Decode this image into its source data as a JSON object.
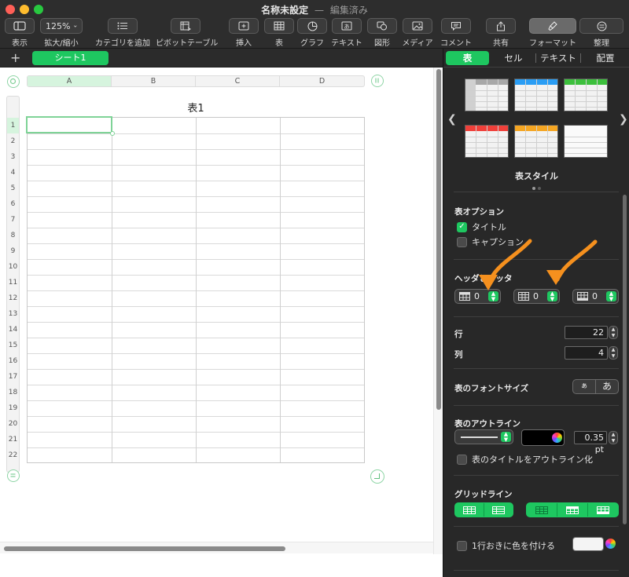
{
  "window": {
    "title": "名称未設定",
    "separator": "—",
    "status": "編集済み"
  },
  "toolbar": {
    "view_label": "表示",
    "zoom_value": "125%",
    "zoom_label": "拡大/縮小",
    "categories_label": "カテゴリを追加",
    "pivot_label": "ピボットテーブル",
    "insert_label": "挿入",
    "table_label": "表",
    "chart_label": "グラフ",
    "text_label": "テキスト",
    "shape_label": "図形",
    "media_label": "メディア",
    "comment_label": "コメント",
    "share_label": "共有",
    "format_label": "フォーマット",
    "organize_label": "整理"
  },
  "sheets": {
    "add": "+",
    "tabs": [
      "シート1"
    ]
  },
  "table": {
    "title": "表1",
    "columns": [
      "A",
      "B",
      "C",
      "D"
    ],
    "rows": [
      "1",
      "2",
      "3",
      "4",
      "5",
      "6",
      "7",
      "8",
      "9",
      "10",
      "11",
      "12",
      "13",
      "14",
      "15",
      "16",
      "17",
      "18",
      "19",
      "20",
      "21",
      "22"
    ]
  },
  "inspector": {
    "tabs": [
      "表",
      "セル",
      "テキスト",
      "配置"
    ],
    "style_label": "表スタイル",
    "table_options": {
      "title": "表オプション",
      "title_checkbox": "タイトル",
      "title_checked": true,
      "caption_checkbox": "キャプション",
      "caption_checked": false
    },
    "headers_footer": {
      "title": "ヘッダとフッタ",
      "header_rows": "0",
      "header_columns": "0",
      "footer_rows": "0"
    },
    "rows_label": "行",
    "rows_value": "22",
    "columns_label": "列",
    "columns_value": "4",
    "font_size_label": "表のフォントサイズ",
    "font_small": "ぁ",
    "font_large": "あ",
    "outline": {
      "title": "表のアウトライン",
      "color": "#000000",
      "width": "0.35 pt",
      "outline_title_checkbox": "表のタイトルをアウトライン化"
    },
    "gridlines_title": "グリッドライン",
    "alternate_rows_checkbox": "1行おきに色を付ける"
  },
  "colors": {
    "accent": "#1ec760",
    "annotation_arrow": "#f5901e",
    "toolbar_bg": "#2d2d2d",
    "inspector_bg": "#282828"
  }
}
